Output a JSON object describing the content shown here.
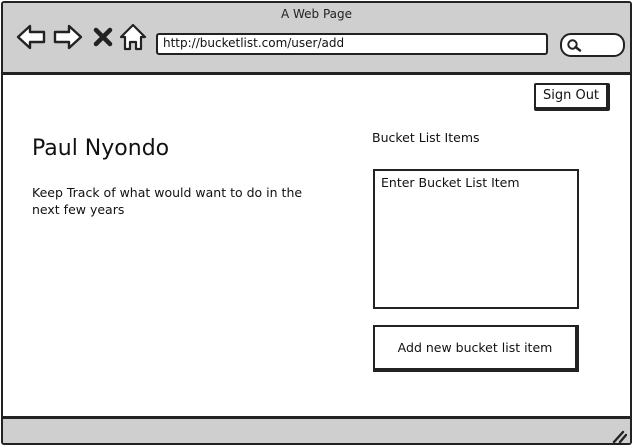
{
  "window": {
    "title": "A Web Page"
  },
  "toolbar": {
    "icons": [
      "back-arrow-icon",
      "forward-arrow-icon",
      "close-x-icon",
      "home-icon"
    ],
    "url": "http://bucketlist.com/user/add",
    "search_icon": "search-icon"
  },
  "header": {
    "signout_label": "Sign Out"
  },
  "profile": {
    "name": "Paul Nyondo",
    "description": "Keep Track of what would want to do in the next few years"
  },
  "bucket_list": {
    "heading": "Bucket List Items",
    "input_placeholder": "Enter Bucket List Item",
    "add_button_label": "Add new bucket list item"
  }
}
